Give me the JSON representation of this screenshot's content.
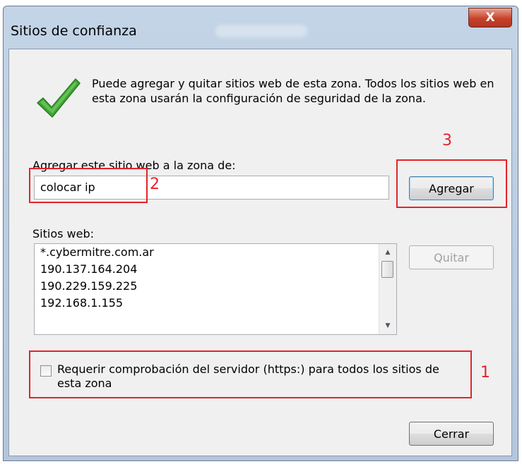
{
  "window": {
    "title": "Sitios de confianza",
    "close_symbol": "X"
  },
  "intro": {
    "icon": "green-checkmark-icon",
    "text": "Puede agregar y quitar sitios web de esta zona. Todos los sitios web en esta zona usarán la configuración de seguridad de la zona."
  },
  "add_site": {
    "label": "Agregar este sitio web a la zona de:",
    "input_value": "colocar ip",
    "add_button": "Agregar"
  },
  "sites": {
    "label": "Sitios web:",
    "items": [
      "*.cybermitre.com.ar",
      "190.137.164.204",
      "190.229.159.225",
      "192.168.1.155"
    ],
    "remove_button": "Quitar"
  },
  "https": {
    "label": "Requerir comprobación del servidor (https:) para todos los sitios de esta zona",
    "checked": false
  },
  "footer": {
    "close_button": "Cerrar"
  },
  "annotations": {
    "marker_1": "1",
    "marker_2": "2",
    "marker_3": "3",
    "color": "#e3242b"
  }
}
